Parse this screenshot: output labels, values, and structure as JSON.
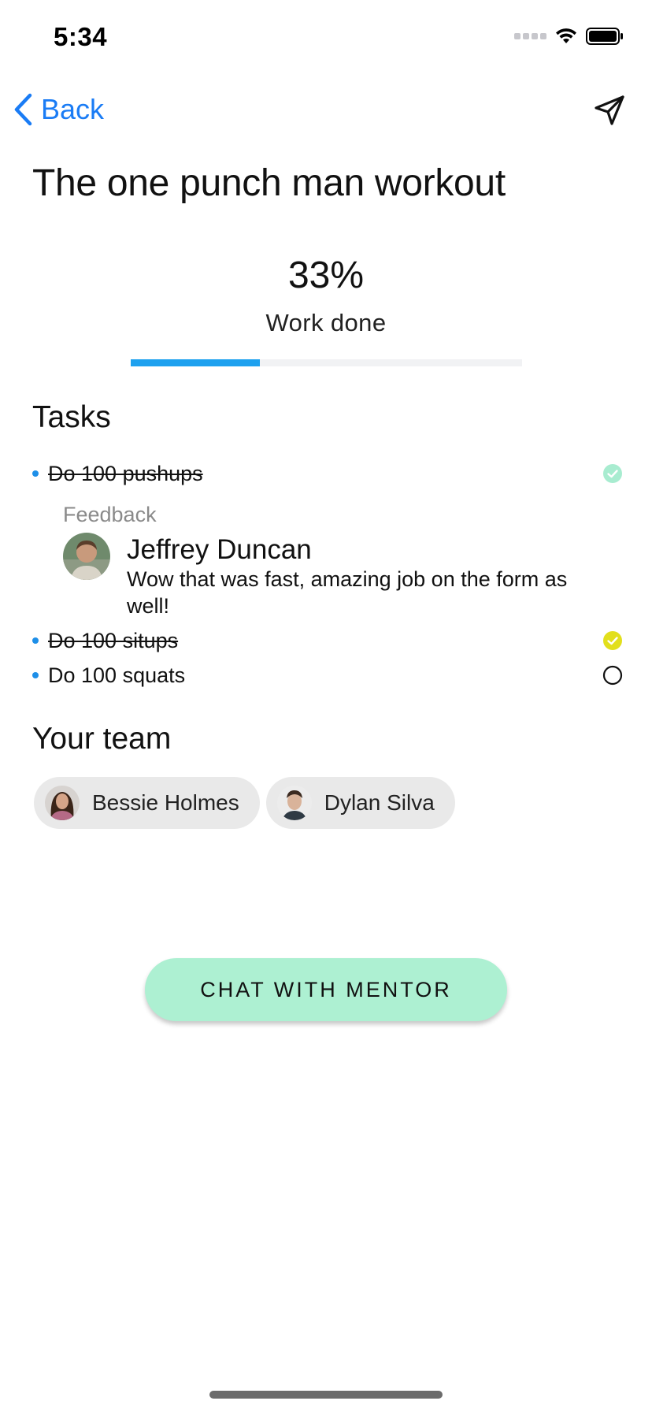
{
  "status_bar": {
    "time": "5:34"
  },
  "nav": {
    "back_label": "Back",
    "accent": "#1a7cf5"
  },
  "title": "The one punch man workout",
  "progress": {
    "percent_text": "33%",
    "label": "Work done",
    "fraction": 0.33,
    "fill_color": "#1ea1ef"
  },
  "tasks_section": {
    "title": "Tasks",
    "items": [
      {
        "text": "Do 100 pushups",
        "done": true,
        "status": "check-mint",
        "status_color": "#a8ecd0"
      },
      {
        "text": "Do 100 situps",
        "done": true,
        "status": "check-yellow",
        "status_color": "#e2df1c"
      },
      {
        "text": "Do 100 squats",
        "done": false,
        "status": "empty-circle",
        "status_color": "#111111"
      }
    ]
  },
  "feedback": {
    "label": "Feedback",
    "author": "Jeffrey Duncan",
    "message": "Wow that was fast, amazing job on the form as well!"
  },
  "team_section": {
    "title": "Your team",
    "members": [
      {
        "name": "Bessie Holmes"
      },
      {
        "name": "Dylan Silva"
      }
    ]
  },
  "chat_button": {
    "label": "CHAT WITH MENTOR",
    "color": "#adf0d2"
  }
}
